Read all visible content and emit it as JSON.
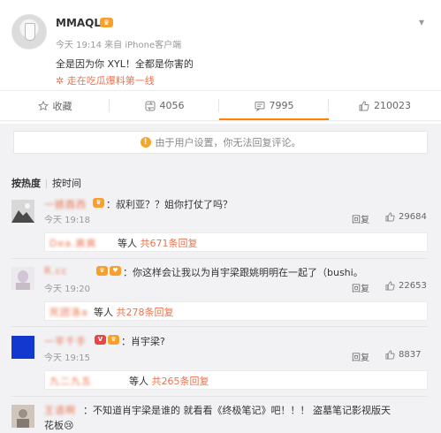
{
  "post": {
    "username": "MMAQL",
    "vip_icon": "vip-crown-badge",
    "meta": "今天 19:14 来自 iPhone客户端",
    "text": "全是因为你 XYL！全都是你害的",
    "topic": "走在吃瓜爆料第一线"
  },
  "actions": [
    {
      "label": "收藏",
      "icon": "star-icon"
    },
    {
      "label": "4056",
      "icon": "share-icon"
    },
    {
      "label": "7995",
      "icon": "comment-icon"
    },
    {
      "label": "210023",
      "icon": "like-icon"
    }
  ],
  "notice": {
    "text": "由于用户设置，你无法回复评论。"
  },
  "sort": {
    "hot": "按热度",
    "time": "按时间"
  },
  "comments": [
    {
      "name_blurred": "一掳酉西",
      "text": "：叔利亚？？姐你打仗了吗？",
      "time": "今天 19:18",
      "reply": "回复",
      "likes": "29684",
      "sub_name": "Dea.爽爽",
      "sub_rest": " 等人 ",
      "sub_count": "共671条回复"
    },
    {
      "name_blurred": "R.cc",
      "text": "：你这样会让我以为肖宇梁跟姚明明在一起了（bushi。",
      "time": "今天 19:20",
      "reply": "回复",
      "likes": "22653",
      "sub_name": "死团洛a",
      "sub_rest": " 等人 ",
      "sub_count": "共278条回复"
    },
    {
      "name_blurred": "一平千手",
      "text": "：肖宇梁?",
      "time": "今天 19:15",
      "reply": "回复",
      "likes": "8837",
      "sub_name": "九二九五",
      "sub_rest": " 等人 ",
      "sub_count": "共265条回复"
    },
    {
      "name_blurred": "王语啊",
      "text": "：不知道肖宇梁是谁的 就看看《终极笔记》吧！！！ 盗墓笔记影视版天",
      "text2": "花板😢"
    }
  ]
}
